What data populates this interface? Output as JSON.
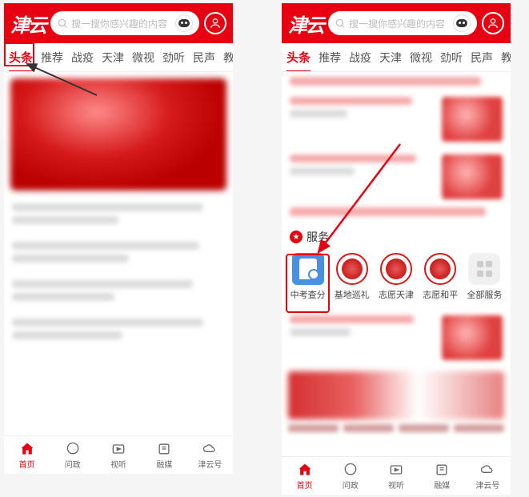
{
  "app": {
    "logo": "津云",
    "search_placeholder": "搜一搜你感兴趣的内容"
  },
  "tabs": [
    "头条",
    "推荐",
    "战疫",
    "天津",
    "微视",
    "劲听",
    "民声",
    "教"
  ],
  "tab_more": "+",
  "service_section": {
    "title": "服务",
    "items": [
      {
        "label": "中考查分"
      },
      {
        "label": "基地巡礼"
      },
      {
        "label": "志愿天津"
      },
      {
        "label": "志愿和平"
      },
      {
        "label": "全部服务"
      }
    ]
  },
  "bottom_nav": [
    {
      "label": "首页"
    },
    {
      "label": "问政"
    },
    {
      "label": "视听"
    },
    {
      "label": "融媒"
    },
    {
      "label": "津云号"
    }
  ],
  "colors": {
    "brand": "#e60012"
  }
}
